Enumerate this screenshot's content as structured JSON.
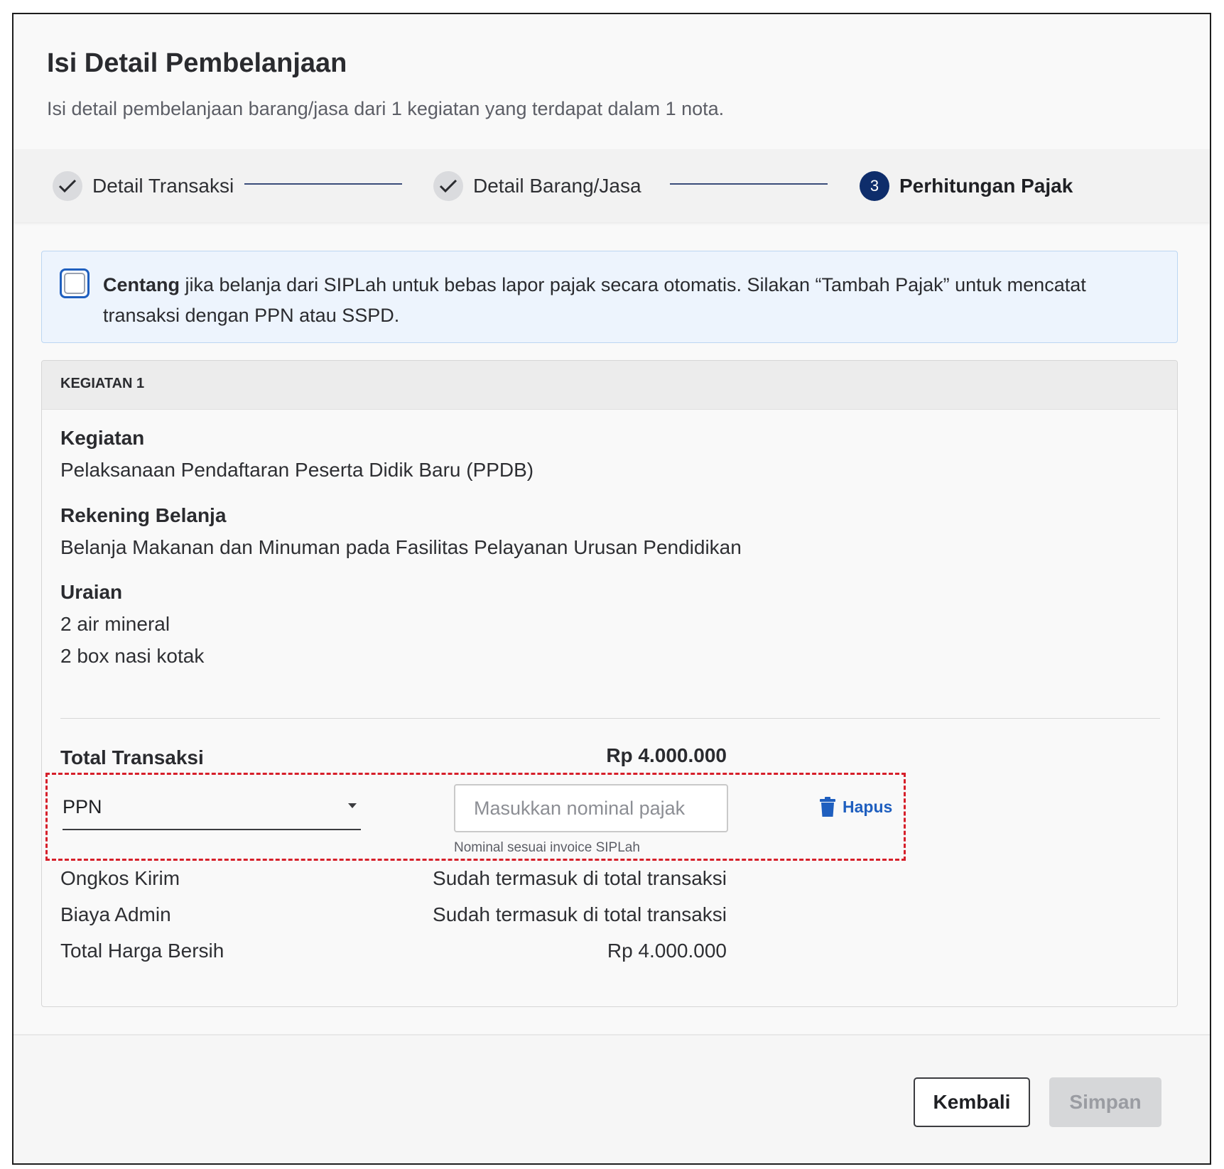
{
  "header": {
    "title": "Isi Detail Pembelanjaan",
    "subtitle": "Isi detail pembelanjaan barang/jasa dari 1 kegiatan yang terdapat dalam 1 nota."
  },
  "stepper": {
    "steps": [
      {
        "label": "Detail Transaksi",
        "status": "done",
        "icon": "check-icon"
      },
      {
        "label": "Detail Barang/Jasa",
        "status": "done",
        "icon": "check-icon"
      },
      {
        "label": "Perhitungan Pajak",
        "status": "active",
        "number": "3"
      }
    ]
  },
  "notice": {
    "checked": false,
    "bold": "Centang",
    "text": " jika belanja dari SIPLah untuk bebas lapor pajak secara otomatis. Silakan “Tambah Pajak” untuk mencatat transaksi dengan PPN atau SSPD."
  },
  "card": {
    "heading": "KEGIATAN 1",
    "kegiatan_label": "Kegiatan",
    "kegiatan_value": "Pelaksanaan Pendaftaran Peserta Didik Baru (PPDB)",
    "rekening_label": "Rekening Belanja",
    "rekening_value": "Belanja Makanan dan Minuman pada Fasilitas Pelayanan Urusan Pendidikan",
    "uraian_label": "Uraian",
    "uraian_items": [
      "2 air mineral",
      "2 box nasi kotak"
    ],
    "total_label": "Total Transaksi",
    "total_value": "Rp 4.000.000",
    "tax": {
      "type_selected": "PPN",
      "input_value": "",
      "input_placeholder": "Masukkan nominal pajak",
      "helper": "Nominal sesuai invoice SIPLah",
      "delete_label": "Hapus",
      "delete_icon": "trash-icon",
      "highlight_color": "#d61f2a"
    },
    "rows": [
      {
        "label": "Ongkos Kirim",
        "value": "Sudah termasuk di total transaksi"
      },
      {
        "label": "Biaya Admin",
        "value": "Sudah termasuk di total transaksi"
      },
      {
        "label": "Total Harga Bersih",
        "value": "Rp 4.000.000"
      }
    ]
  },
  "footer": {
    "back_label": "Kembali",
    "save_label": "Simpan",
    "save_disabled": true
  },
  "colors": {
    "accent": "#1f5fbf",
    "step_active": "#0e2d6b",
    "notice_bg": "#edf4fd"
  }
}
